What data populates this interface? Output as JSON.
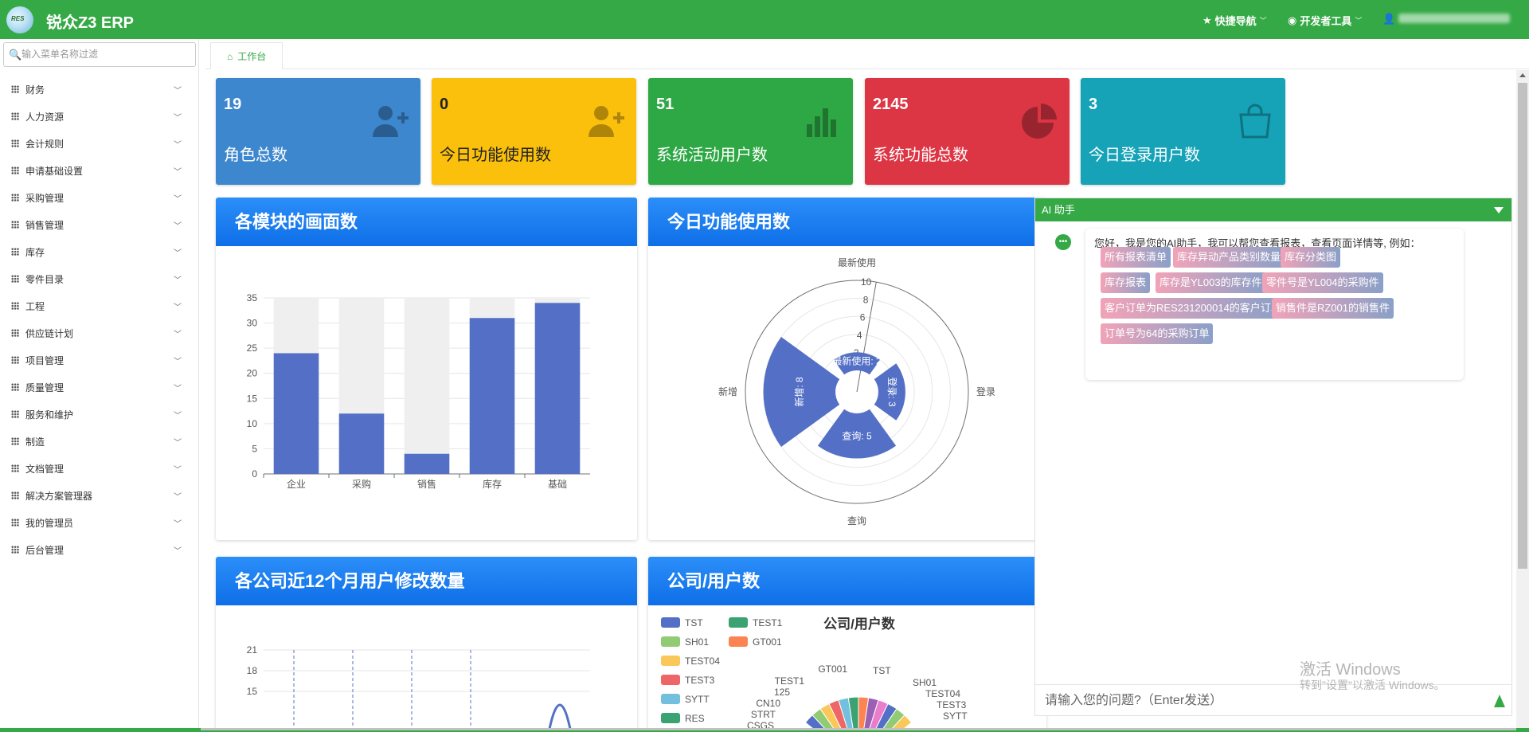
{
  "header": {
    "app_title": "锐众Z3 ERP",
    "logo_text": "RES",
    "nav_shortcut": "快捷导航",
    "nav_devtools": "开发者工具",
    "colors": {
      "brand": "#35a945"
    }
  },
  "sidebar": {
    "search_placeholder": "输入菜单名称过滤",
    "items": [
      {
        "label": "财务"
      },
      {
        "label": "人力资源"
      },
      {
        "label": "会计规则"
      },
      {
        "label": "申请基础设置"
      },
      {
        "label": "采购管理"
      },
      {
        "label": "销售管理"
      },
      {
        "label": "库存"
      },
      {
        "label": "零件目录"
      },
      {
        "label": "工程"
      },
      {
        "label": "供应链计划"
      },
      {
        "label": "项目管理"
      },
      {
        "label": "质量管理"
      },
      {
        "label": "服务和维护"
      },
      {
        "label": "制造"
      },
      {
        "label": "文档管理"
      },
      {
        "label": "解决方案管理器"
      },
      {
        "label": "我的管理员"
      },
      {
        "label": "后台管理"
      }
    ]
  },
  "tabs": [
    {
      "label": "工作台"
    }
  ],
  "stats": [
    {
      "value": "19",
      "label": "角色总数",
      "color": "#3d87ce",
      "icon": "user-plus-icon"
    },
    {
      "value": "0",
      "label": "今日功能使用数",
      "color": "#fbc00c",
      "icon": "user-plus-icon"
    },
    {
      "value": "51",
      "label": "系统活动用户数",
      "color": "#2ea845",
      "icon": "bar-chart-icon"
    },
    {
      "value": "2145",
      "label": "系统功能总数",
      "color": "#dc3544",
      "icon": "pie-chart-icon"
    },
    {
      "value": "3",
      "label": "今日登录用户数",
      "color": "#16a3b7",
      "icon": "shopping-bag-icon"
    }
  ],
  "panels": {
    "module_screens": {
      "title": "各模块的画面数"
    },
    "today_usage": {
      "title": "今日功能使用数"
    },
    "company_changes": {
      "title": "各公司近12个月用户修改数量"
    },
    "company_users": {
      "title": "公司/用户数",
      "chart_title": "公司/用户数"
    }
  },
  "chart_data": [
    {
      "type": "bar",
      "categories": [
        "企业",
        "采购",
        "销售",
        "库存",
        "基础"
      ],
      "values": [
        24,
        12,
        4,
        31,
        34
      ],
      "ylim": [
        0,
        35
      ],
      "yticks": [
        0,
        5,
        10,
        15,
        20,
        25,
        30,
        35
      ],
      "color": "#5470c6",
      "background_bar": true
    },
    {
      "type": "polar-bar",
      "categories": [
        "最新使用",
        "登录",
        "查询",
        "新增"
      ],
      "values": [
        2,
        3,
        5,
        8
      ],
      "data_labels": [
        "最新使用: 2",
        "登录: 3",
        "查询: 5",
        "新增: 8"
      ],
      "radial_ticks": [
        2,
        4,
        6,
        8,
        10
      ],
      "color": "#5470c6"
    },
    {
      "type": "line",
      "yticks": [
        15,
        18,
        21
      ],
      "partial": true
    },
    {
      "type": "pie",
      "title": "公司/用户数",
      "legend": [
        {
          "name": "TST",
          "color": "#5470c6"
        },
        {
          "name": "TEST1",
          "color": "#3ba272"
        },
        {
          "name": "SH01",
          "color": "#91cc75"
        },
        {
          "name": "GT001",
          "color": "#fc8452"
        },
        {
          "name": "TEST04",
          "color": "#fac858"
        },
        {
          "name": "TEST3",
          "color": "#ee6666"
        },
        {
          "name": "SYTT",
          "color": "#73c0de"
        },
        {
          "name": "RES",
          "color": "#3ba272"
        }
      ],
      "slice_labels": [
        "GT001",
        "TST",
        "SH01",
        "TEST04",
        "TEST3",
        "SYTT",
        "TEST1",
        "125",
        "CN10",
        "STRT",
        "CSGS"
      ]
    }
  ],
  "ai_assistant": {
    "title": "AI 助手",
    "greeting": "您好，我是您的AI助手，我可以帮您查看报表，查看页面详情等, 例如：",
    "suggestions": [
      {
        "label": "所有报表清单"
      },
      {
        "label": "库存异动产品类别数量"
      },
      {
        "label": "库存分类图"
      },
      {
        "label": "库存报表"
      },
      {
        "label": "库存是YL003的库存件"
      },
      {
        "label": "零件号是YL004的采购件"
      },
      {
        "label": "客户订单为RES231200014的客户订单"
      },
      {
        "label": "销售件是RZ001的销售件"
      },
      {
        "label": "订单号为64的采购订单"
      }
    ],
    "input_placeholder": "请输入您的问题?（Enter发送）"
  },
  "watermark": {
    "line1": "激活 Windows",
    "line2": "转到\"设置\"以激活 Windows。"
  }
}
